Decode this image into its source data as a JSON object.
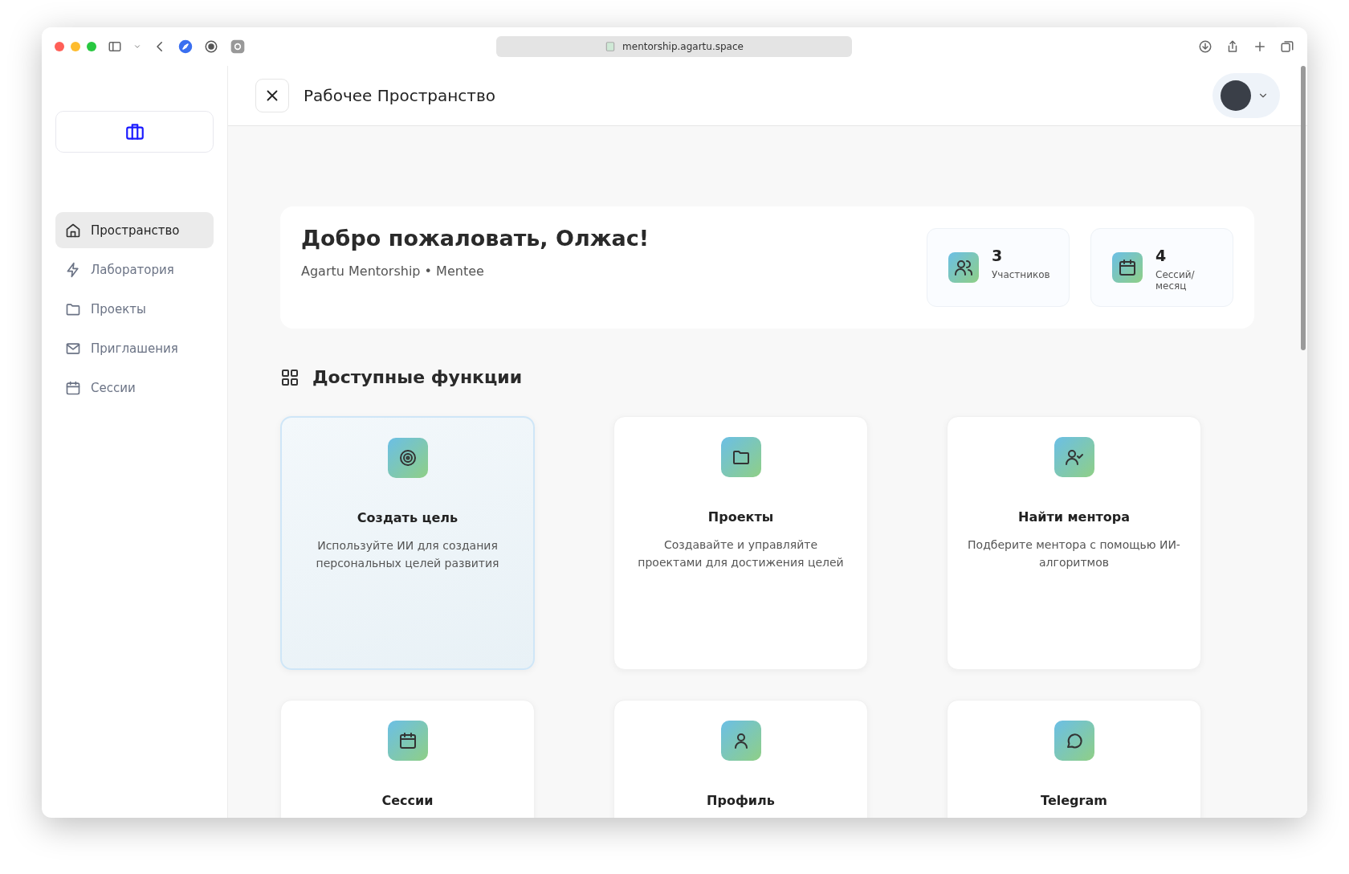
{
  "browser": {
    "url": "mentorship.agartu.space"
  },
  "header": {
    "title": "Рабочее Пространство"
  },
  "sidebar": {
    "items": [
      {
        "label": "Пространство",
        "selected": true
      },
      {
        "label": "Лаборатория",
        "selected": false
      },
      {
        "label": "Проекты",
        "selected": false
      },
      {
        "label": "Приглашения",
        "selected": false
      },
      {
        "label": "Сессии",
        "selected": false
      }
    ]
  },
  "welcome": {
    "title": "Добро пожаловать, Олжас!",
    "subtitle": "Agartu Mentorship • Mentee",
    "stats": [
      {
        "value": "3",
        "label": "Участников"
      },
      {
        "value": "4",
        "label": "Сессий/месяц"
      }
    ]
  },
  "features": {
    "title": "Доступные функции",
    "cards": [
      {
        "title": "Создать цель",
        "description": "Используйте ИИ для создания персональных целей развития",
        "highlighted": true
      },
      {
        "title": "Проекты",
        "description": "Создавайте и управляйте проектами для достижения целей",
        "highlighted": false
      },
      {
        "title": "Найти ментора",
        "description": "Подберите ментора с помощью ИИ-алгоритмов",
        "highlighted": false
      },
      {
        "title": "Сессии",
        "highlighted": false
      },
      {
        "title": "Профиль",
        "highlighted": false
      },
      {
        "title": "Telegram",
        "highlighted": false
      }
    ]
  }
}
